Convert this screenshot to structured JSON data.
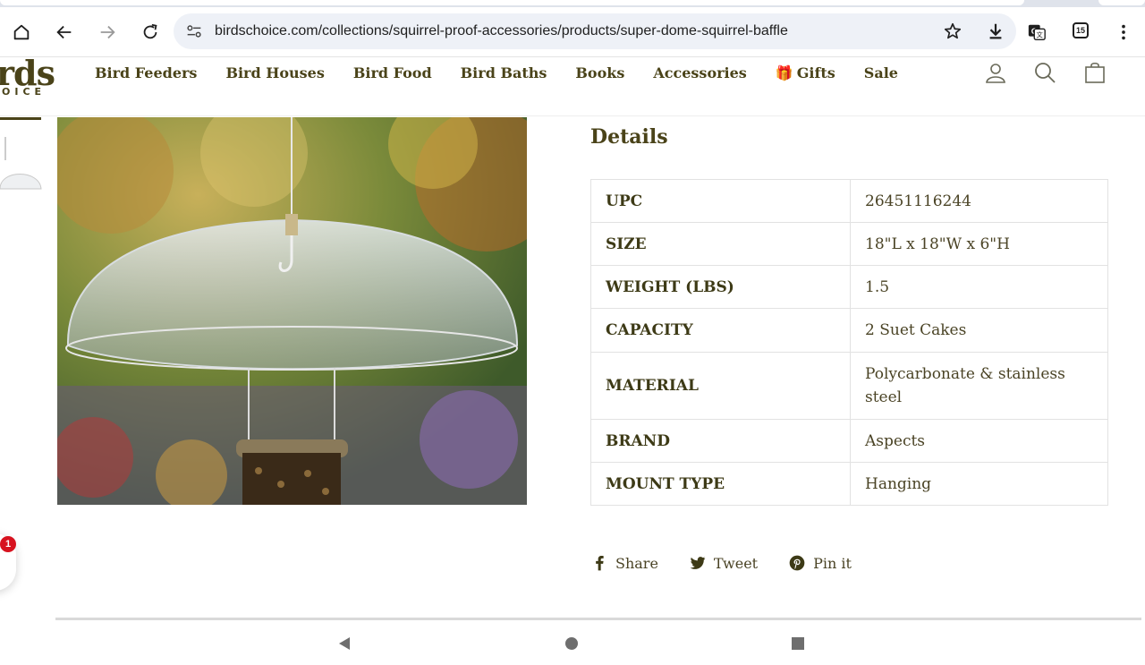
{
  "browser": {
    "url": "birdschoice.com/collections/squirrel-proof-accessories/products/super-dome-squirrel-baffle",
    "tab_count": "15"
  },
  "site": {
    "logo_main": "rds",
    "logo_sub": "OICE",
    "brand_color": "#4a4319",
    "nav": [
      {
        "label": "Bird Feeders"
      },
      {
        "label": "Bird Houses"
      },
      {
        "label": "Bird Food"
      },
      {
        "label": "Bird Baths"
      },
      {
        "label": "Books"
      },
      {
        "label": "Accessories"
      },
      {
        "label": "Gifts",
        "icon": "gift-icon"
      },
      {
        "label": "Sale"
      }
    ]
  },
  "details": {
    "title": "Details",
    "rows": [
      {
        "key": "UPC",
        "value": "26451116244"
      },
      {
        "key": "SIZE",
        "value": "18\"L x 18\"W x 6\"H"
      },
      {
        "key": "WEIGHT (LBS)",
        "value": "1.5"
      },
      {
        "key": "CAPACITY",
        "value": "2 Suet Cakes"
      },
      {
        "key": "MATERIAL",
        "value": "Polycarbonate & stainless steel"
      },
      {
        "key": "BRAND",
        "value": "Aspects"
      },
      {
        "key": "MOUNT TYPE",
        "value": "Hanging"
      }
    ]
  },
  "share": {
    "facebook": "Share",
    "twitter": "Tweet",
    "pinterest": "Pin it"
  },
  "chat": {
    "badge": "1"
  }
}
